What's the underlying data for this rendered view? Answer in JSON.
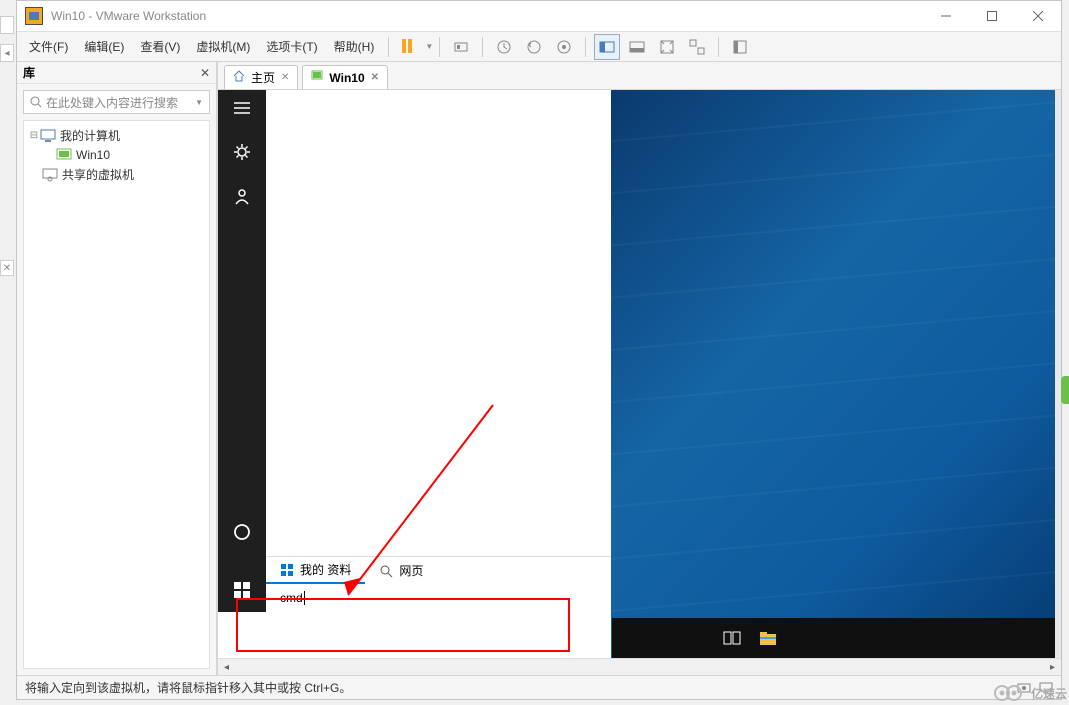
{
  "titlebar": {
    "title": "Win10 - VMware Workstation"
  },
  "menus": [
    "文件(F)",
    "编辑(E)",
    "查看(V)",
    "虚拟机(M)",
    "选项卡(T)",
    "帮助(H)"
  ],
  "library": {
    "title": "库",
    "search_placeholder": "在此处键入内容进行搜索",
    "items": {
      "root": "我的计算机",
      "vm": "Win10",
      "shared": "共享的虚拟机"
    }
  },
  "tabs": {
    "home": "主页",
    "vm": "Win10"
  },
  "start_menu": {
    "search_value": "cmd",
    "tab_my": "我的 资料",
    "tab_web": "网页"
  },
  "statusbar": {
    "text": "将输入定向到该虚拟机，请将鼠标指针移入其中或按 Ctrl+G。"
  },
  "watermark": "亿速云"
}
